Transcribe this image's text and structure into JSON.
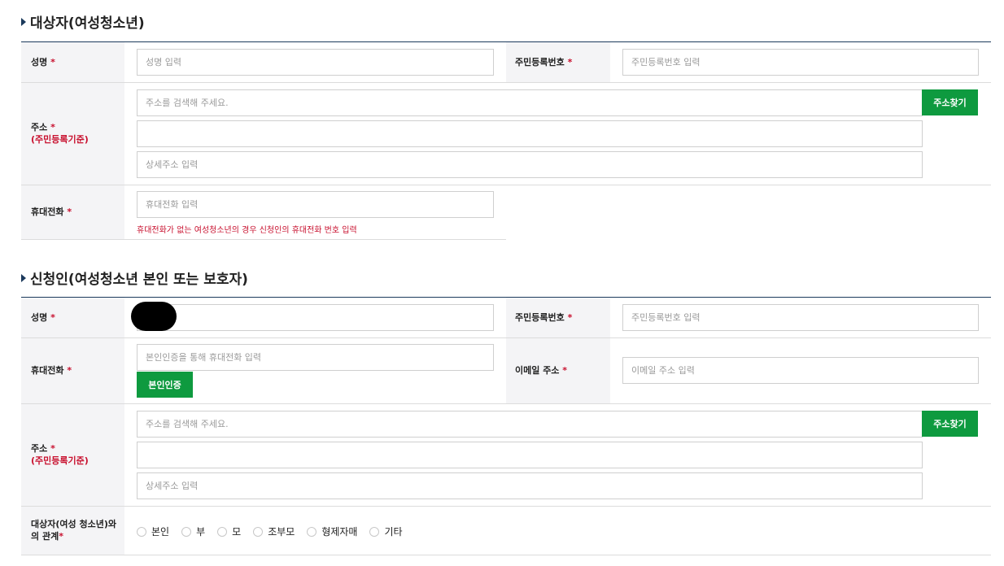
{
  "section1": {
    "title": "대상자(여성청소년)",
    "name_label": "성명",
    "name_placeholder": "성명 입력",
    "rrn_label": "주민등록번호",
    "rrn_placeholder": "주민등록번호 입력",
    "address_label": "주소",
    "address_sub": "(주민등록기준)",
    "address_search_placeholder": "주소를 검색해 주세요.",
    "address_search_button": "주소찾기",
    "address_detail_placeholder": "상세주소 입력",
    "phone_label": "휴대전화",
    "phone_placeholder": "휴대전화 입력",
    "phone_note": "휴대전화가 없는 여성청소년의 경우 신청인의 휴대전화 번호 입력"
  },
  "section2": {
    "title": "신청인(여성청소년 본인 또는 보호자)",
    "name_label": "성명",
    "rrn_label": "주민등록번호",
    "rrn_placeholder": "주민등록번호 입력",
    "phone_label": "휴대전화",
    "phone_placeholder": "본인인증을 통해 휴대전화 입력",
    "verify_button": "본인인증",
    "email_label": "이메일 주소",
    "email_placeholder": "이메일 주소 입력",
    "address_label": "주소",
    "address_sub": "(주민등록기준)",
    "address_search_placeholder": "주소를 검색해 주세요.",
    "address_search_button": "주소찾기",
    "address_detail_placeholder": "상세주소 입력",
    "relation_label_line1": "대상자(여성 청소년)와",
    "relation_label_line2": "의 관계",
    "relation_options": [
      "본인",
      "부",
      "모",
      "조부모",
      "형제자매",
      "기타"
    ]
  },
  "required_mark": "*"
}
